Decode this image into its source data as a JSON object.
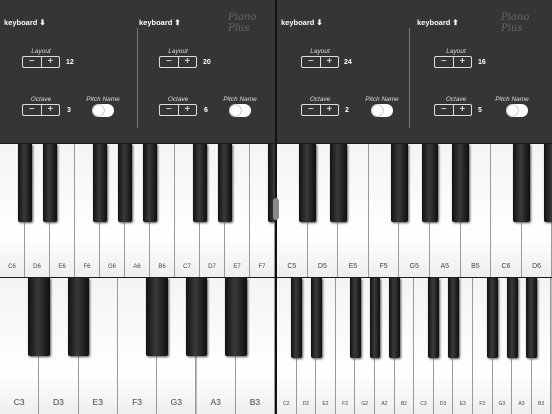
{
  "panels": [
    {
      "brand": "Piano Plus",
      "sections": [
        {
          "keyboard_label": "keyboard ⬇",
          "layout_caption": "Layout",
          "layout_value": "12",
          "octave_caption": "Octave",
          "octave_value": "3",
          "pitch_caption": "Pitch Name"
        },
        {
          "keyboard_label": "keyboard ⬆",
          "layout_caption": "Layout",
          "layout_value": "20",
          "octave_caption": "Octave",
          "octave_value": "6",
          "pitch_caption": "Pitch Name"
        }
      ]
    },
    {
      "brand": "Piano Plus",
      "sections": [
        {
          "keyboard_label": "keyboard ⬇",
          "layout_caption": "Layout",
          "layout_value": "24",
          "octave_caption": "Octave",
          "octave_value": "2",
          "pitch_caption": "Pitch Name"
        },
        {
          "keyboard_label": "keyboard ⬆",
          "layout_caption": "Layout",
          "layout_value": "16",
          "octave_caption": "Octave",
          "octave_value": "5",
          "pitch_caption": "Pitch Name"
        }
      ]
    }
  ],
  "stepper": {
    "minus": "−",
    "plus": "+"
  },
  "keyboards": [
    {
      "id": "left-top",
      "whites": [
        "C6",
        "D6",
        "E6",
        "F6",
        "G6",
        "A6",
        "B6",
        "C7",
        "D7",
        "E7",
        "F7"
      ],
      "blacks_after": [
        0,
        1,
        3,
        4,
        5,
        7,
        8,
        10
      ]
    },
    {
      "id": "left-bottom",
      "whites": [
        "C3",
        "D3",
        "E3",
        "F3",
        "G3",
        "A3",
        "B3"
      ],
      "blacks_after": [
        0,
        1,
        3,
        4,
        5
      ]
    },
    {
      "id": "right-top",
      "whites": [
        "C5",
        "D5",
        "E5",
        "F5",
        "G5",
        "A5",
        "B5",
        "C6",
        "D6"
      ],
      "blacks_after": [
        0,
        1,
        3,
        4,
        5,
        7,
        8
      ]
    },
    {
      "id": "right-bottom",
      "whites": [
        "C2",
        "D2",
        "E2",
        "F2",
        "G2",
        "A2",
        "B2",
        "C3",
        "D3",
        "E3",
        "F3",
        "G3",
        "A3",
        "B3"
      ],
      "blacks_after": [
        0,
        1,
        3,
        4,
        5,
        7,
        8,
        10,
        11,
        12
      ]
    }
  ]
}
